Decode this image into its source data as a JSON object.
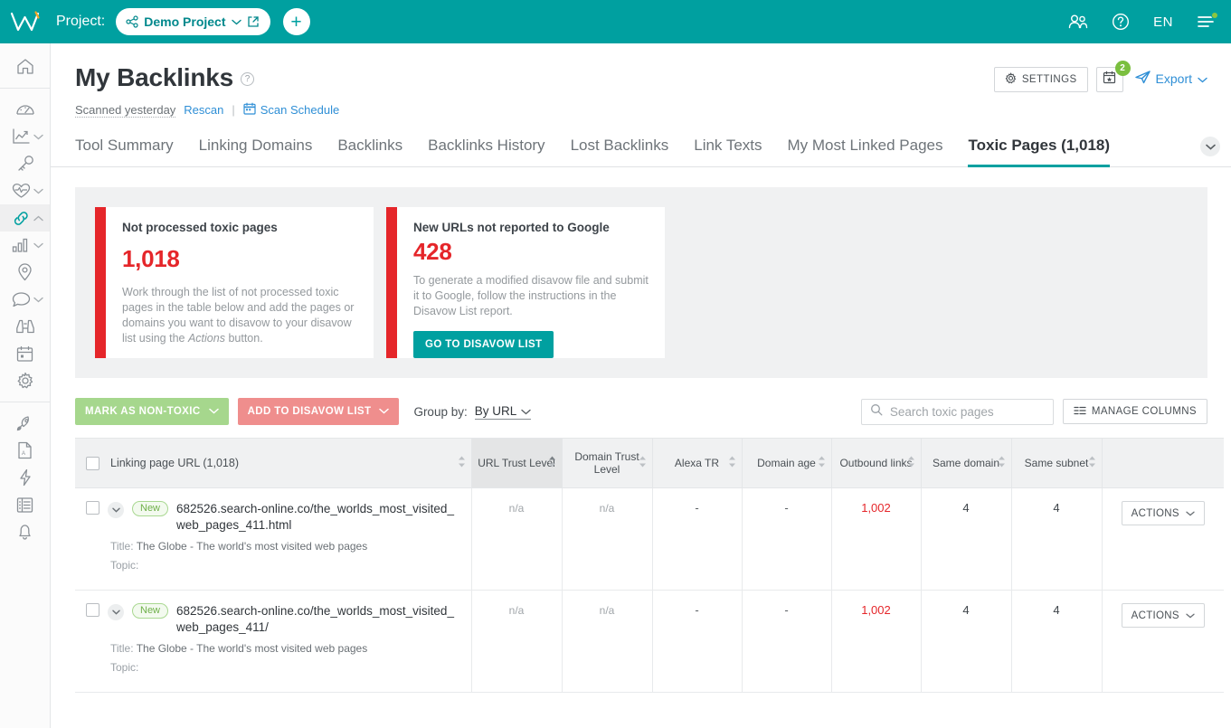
{
  "topbar": {
    "project_label": "Project:",
    "project_name": "Demo Project",
    "add_button": "+",
    "lang": "EN",
    "icons": {
      "users": "users-icon",
      "help": "help-icon",
      "menu": "hamburger-menu-icon"
    },
    "menu_badge_color": "#8cc63f",
    "bg_color": "#00a0a0"
  },
  "sidebar": {
    "items": [
      {
        "name": "home",
        "icon": "home-icon",
        "caret": false,
        "active": false
      },
      {
        "name": "dashboard",
        "icon": "gauge-icon",
        "caret": false,
        "active": false
      },
      {
        "name": "rank-tracking",
        "icon": "chart-line-icon",
        "caret": true,
        "active": false
      },
      {
        "name": "keyword-research",
        "icon": "key-icon",
        "caret": false,
        "active": false
      },
      {
        "name": "site-audit",
        "icon": "heartbeat-icon",
        "caret": true,
        "active": false
      },
      {
        "name": "backlinks",
        "icon": "link-icon",
        "caret": true,
        "active": true
      },
      {
        "name": "traffic-analytics",
        "icon": "bar-chart-icon",
        "caret": true,
        "active": false
      },
      {
        "name": "local-seo",
        "icon": "map-pin-icon",
        "caret": false,
        "active": false
      },
      {
        "name": "social-media",
        "icon": "chat-bubble-icon",
        "caret": true,
        "active": false
      },
      {
        "name": "competitors",
        "icon": "binoculars-icon",
        "caret": false,
        "active": false
      },
      {
        "name": "content-calendar",
        "icon": "calendar-icon",
        "caret": false,
        "active": false
      },
      {
        "name": "settings",
        "icon": "gear-icon",
        "caret": false,
        "active": false
      },
      {
        "name": "boost",
        "icon": "rocket-icon",
        "caret": false,
        "active": false
      },
      {
        "name": "pdf-reports",
        "icon": "pdf-file-icon",
        "caret": false,
        "active": false
      },
      {
        "name": "quick-actions",
        "icon": "lightning-bolt-icon",
        "caret": false,
        "active": false
      },
      {
        "name": "tasks",
        "icon": "list-checklist-icon",
        "caret": false,
        "active": false
      },
      {
        "name": "notifications",
        "icon": "bell-icon",
        "caret": false,
        "active": false
      }
    ]
  },
  "page": {
    "title": "My Backlinks",
    "help_icon": "question-mark-icon",
    "scanned_text": "Scanned yesterday",
    "rescan_label": "Rescan",
    "separator": "|",
    "scan_schedule_label": "Scan Schedule",
    "settings_label": "SETTINGS",
    "calendar_badge": "2",
    "export_label": "Export"
  },
  "tabs": [
    {
      "label": "Tool Summary",
      "active": false
    },
    {
      "label": "Linking Domains",
      "active": false
    },
    {
      "label": "Backlinks",
      "active": false
    },
    {
      "label": "Backlinks History",
      "active": false
    },
    {
      "label": "Lost Backlinks",
      "active": false
    },
    {
      "label": "Link Texts",
      "active": false
    },
    {
      "label": "My Most Linked Pages",
      "active": false
    },
    {
      "label": "Toxic Pages (1,018)",
      "active": true
    }
  ],
  "cards": [
    {
      "title": "Not processed toxic pages",
      "value": "1,018",
      "text_before": "Work through the list of not processed toxic pages in the table below and add the pages or domains you want to disavow to your disavow list using the ",
      "text_italic": "Actions",
      "text_after": " button.",
      "accent": "#e5262a"
    },
    {
      "title": "New URLs not reported to Google",
      "value": "428",
      "text": "To generate a modified disavow file and submit it to Google, follow the instructions in the Disavow List report.",
      "button": "GO TO DISAVOW LIST",
      "accent": "#e5262a"
    }
  ],
  "toolbar": {
    "mark_non_toxic": "MARK AS NON-TOXIC",
    "add_disavow": "ADD TO DISAVOW LIST",
    "group_by_label": "Group by:",
    "group_by_value": "By URL",
    "search_placeholder": "Search toxic pages",
    "manage_columns": "MANAGE COLUMNS"
  },
  "table": {
    "columns": [
      {
        "label": "Linking page URL (1,018)",
        "sorted": false
      },
      {
        "label": "URL Trust Level",
        "sorted": true
      },
      {
        "label": "Domain Trust Level",
        "sorted": false
      },
      {
        "label": "Alexa TR",
        "sorted": false
      },
      {
        "label": "Domain age",
        "sorted": false
      },
      {
        "label": "Outbound links",
        "sorted": false
      },
      {
        "label": "Same domain",
        "sorted": false
      },
      {
        "label": "Same subnet",
        "sorted": false
      },
      {
        "label": "",
        "sorted": false
      }
    ],
    "rows": [
      {
        "badge": "New",
        "url": "682526.search-online.co/the_worlds_most_visited_web_pages_411.html",
        "title_label": "Title:",
        "title_value": "The Globe - The world's most visited web pages",
        "topic_label": "Topic:",
        "topic_value": "",
        "url_trust": "n/a",
        "domain_trust": "n/a",
        "alexa_tr": "-",
        "domain_age": "-",
        "outbound_links": "1,002",
        "same_domain": "4",
        "same_subnet": "4",
        "action_label": "ACTIONS"
      },
      {
        "badge": "New",
        "url": "682526.search-online.co/the_worlds_most_visited_web_pages_411/",
        "title_label": "Title:",
        "title_value": "The Globe - The world's most visited web pages",
        "topic_label": "Topic:",
        "topic_value": "",
        "url_trust": "n/a",
        "domain_trust": "n/a",
        "alexa_tr": "-",
        "domain_age": "-",
        "outbound_links": "1,002",
        "same_domain": "4",
        "same_subnet": "4",
        "action_label": "ACTIONS"
      }
    ]
  }
}
